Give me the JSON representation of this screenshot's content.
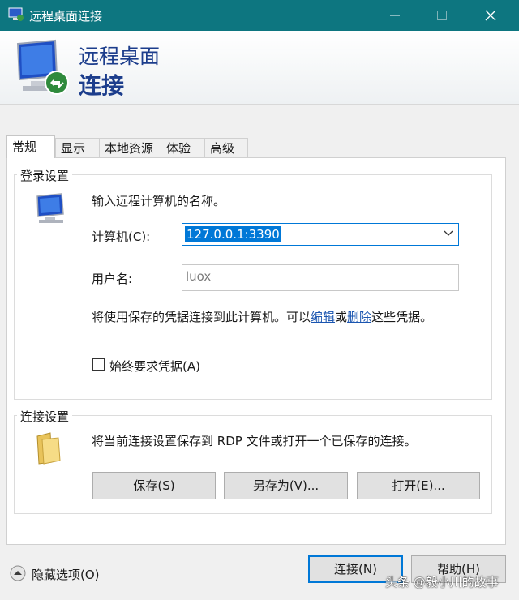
{
  "window": {
    "title": "远程桌面连接",
    "controls": {
      "minimize": "minimize",
      "maximize": "maximize",
      "close": "close"
    }
  },
  "header": {
    "line1": "远程桌面",
    "line2": "连接"
  },
  "tabs": [
    {
      "label": "常规",
      "active": true
    },
    {
      "label": "显示",
      "active": false
    },
    {
      "label": "本地资源",
      "active": false
    },
    {
      "label": "体验",
      "active": false
    },
    {
      "label": "高级",
      "active": false
    }
  ],
  "login": {
    "group_label": "登录设置",
    "prompt": "输入远程计算机的名称。",
    "computer_label": "计算机(C):",
    "computer_value": "127.0.0.1:3390",
    "username_label": "用户名:",
    "username_value": "luox",
    "creds_prefix": "将使用保存的凭据连接到此计算机。可以",
    "edit_link": "编辑",
    "or_text": "或",
    "delete_link": "删除",
    "creds_suffix": "这些凭据。",
    "always_ask_label": "始终要求凭据(A)",
    "always_ask_checked": false
  },
  "connection": {
    "group_label": "连接设置",
    "description": "将当前连接设置保存到 RDP 文件或打开一个已保存的连接。",
    "save_button": "保存(S)",
    "save_as_button": "另存为(V)...",
    "open_button": "打开(E)..."
  },
  "footer": {
    "hide_options": "隐藏选项(O)",
    "connect_button": "连接(N)",
    "help_button": "帮助(H)"
  },
  "watermark": "头条 @毅小川的故事",
  "colors": {
    "titlebar": "#0d7680",
    "accent": "#0078d7",
    "heading": "#1c3d8c",
    "link": "#1a55b0"
  }
}
